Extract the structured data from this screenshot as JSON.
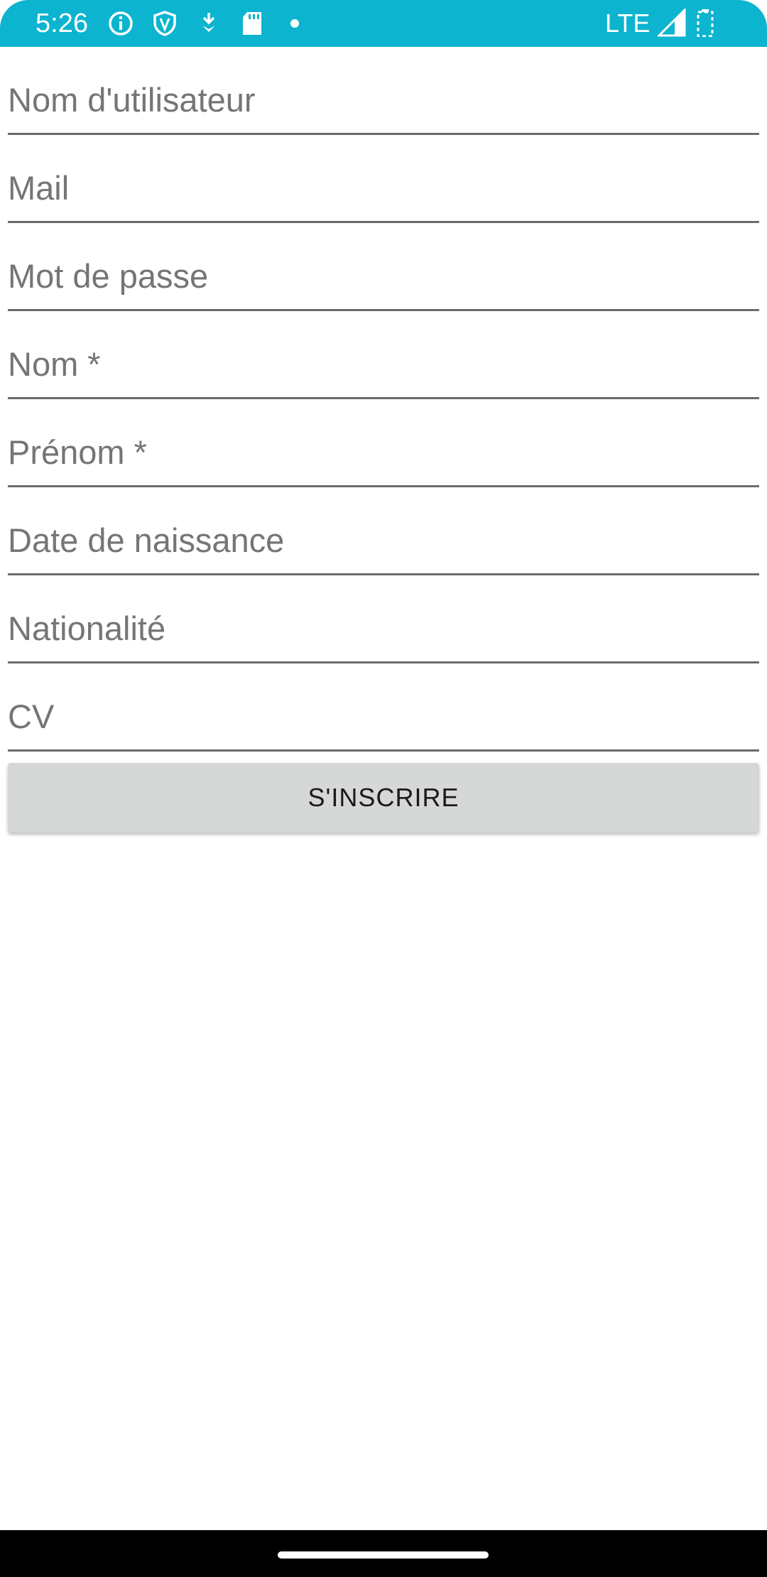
{
  "status_bar": {
    "time": "5:26",
    "network": "LTE",
    "icons": [
      "info-icon",
      "shield-icon",
      "download-icon",
      "sd-card-icon",
      "dot-icon",
      "signal-icon",
      "battery-icon"
    ]
  },
  "form": {
    "fields": [
      {
        "placeholder": "Nom d'utilisateur",
        "value": ""
      },
      {
        "placeholder": "Mail",
        "value": ""
      },
      {
        "placeholder": "Mot de passe",
        "value": ""
      },
      {
        "placeholder": "Nom *",
        "value": ""
      },
      {
        "placeholder": "Prénom *",
        "value": ""
      },
      {
        "placeholder": "Date de naissance",
        "value": ""
      },
      {
        "placeholder": "Nationalité",
        "value": ""
      },
      {
        "placeholder": "CV",
        "value": ""
      }
    ],
    "submit_label": "S'INSCRIRE"
  },
  "colors": {
    "status_bar": "#0cb4cf",
    "button_bg": "#d6d7d7",
    "underline": "#6b6b6b"
  }
}
